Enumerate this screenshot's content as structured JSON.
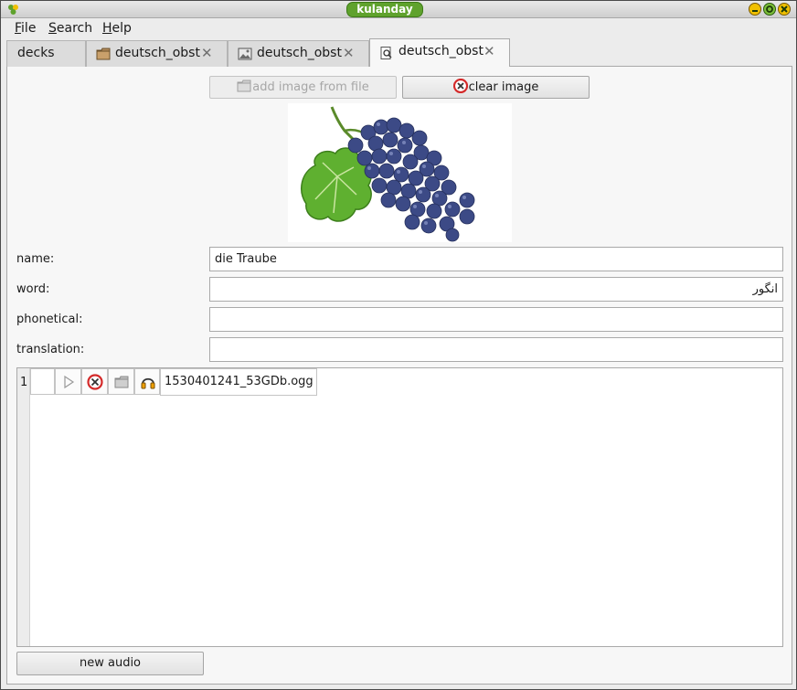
{
  "window": {
    "title": "kulanday"
  },
  "menu": [
    {
      "label": "File",
      "mnemonic": "F",
      "rest": "ile"
    },
    {
      "label": "Search",
      "mnemonic": "S",
      "rest": "earch"
    },
    {
      "label": "Help",
      "mnemonic": "H",
      "rest": "elp"
    }
  ],
  "tabs": [
    {
      "label": "decks",
      "icon": "none"
    },
    {
      "label": "deutsch_obst",
      "icon": "folder-icon"
    },
    {
      "label": "deutsch_obst",
      "icon": "image-icon"
    },
    {
      "label": "deutsch_obst",
      "icon": "document-search-icon"
    }
  ],
  "toolbar": {
    "add_image_label": "add image from file",
    "clear_image_label": "clear image"
  },
  "image": {
    "subject": "bunch of purple grapes with green leaf"
  },
  "fields": {
    "name": {
      "label": "name:",
      "value": "die Traube"
    },
    "word": {
      "label": "word:",
      "value": "انگور"
    },
    "phonetical": {
      "label": "phonetical:",
      "value": ""
    },
    "translation": {
      "label": "translation:",
      "value": ""
    }
  },
  "audio": {
    "rows": [
      {
        "index": "1",
        "filename": "1530401241_53GDb.ogg"
      }
    ]
  },
  "new_audio_label": "new audio",
  "colors": {
    "title_pill": "#5fa22d",
    "delete_red": "#d42a2a",
    "headphones_orange": "#f0a000"
  }
}
